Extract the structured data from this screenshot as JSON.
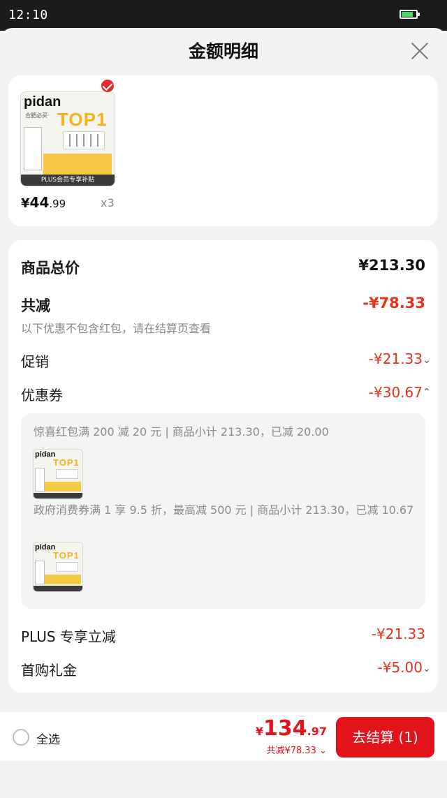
{
  "status_bar": {
    "time": "12:10",
    "battery_level": 0.8
  },
  "header": {
    "title": "金额明细"
  },
  "product": {
    "thumbnail": {
      "brand": "pidan",
      "badge": "TOP1",
      "tag": "合肥必买",
      "footer": "PLUS会员专享补贴"
    },
    "price_currency": "¥",
    "price_int": "44",
    "price_dec": ".99",
    "quantity": "x3"
  },
  "summary": {
    "subtotal_label": "商品总价",
    "subtotal_value": "¥213.30",
    "discount_label": "共减",
    "discount_value": "-¥78.33",
    "discount_hint": "以下优惠不包含红包，请在结算页查看",
    "promotion_label": "促销",
    "promotion_value": "-¥21.33",
    "coupon_label": "优惠券",
    "coupon_value": "-¥30.67",
    "coupons": [
      {
        "text": "惊喜红包满 200 减 20 元 | 商品小计 213.30，已减 20.00"
      },
      {
        "text": "政府消费券满 1 享 9.5 折，最高减 500 元 | 商品小计 213.30，已减 10.67"
      }
    ],
    "plus_label": "PLUS 专享立减",
    "plus_value": "-¥21.33",
    "first_gift_label": "首购礼金",
    "first_gift_value": "-¥5.00"
  },
  "bottom_bar": {
    "select_all_label": "全选",
    "total_currency": "¥",
    "total_int": "134",
    "total_dec": ".97",
    "saved_text": "共减¥78.33",
    "checkout_label": "去结算 (1)"
  },
  "colors": {
    "accent_red": "#e3131c",
    "discount_red": "#e3331c"
  }
}
